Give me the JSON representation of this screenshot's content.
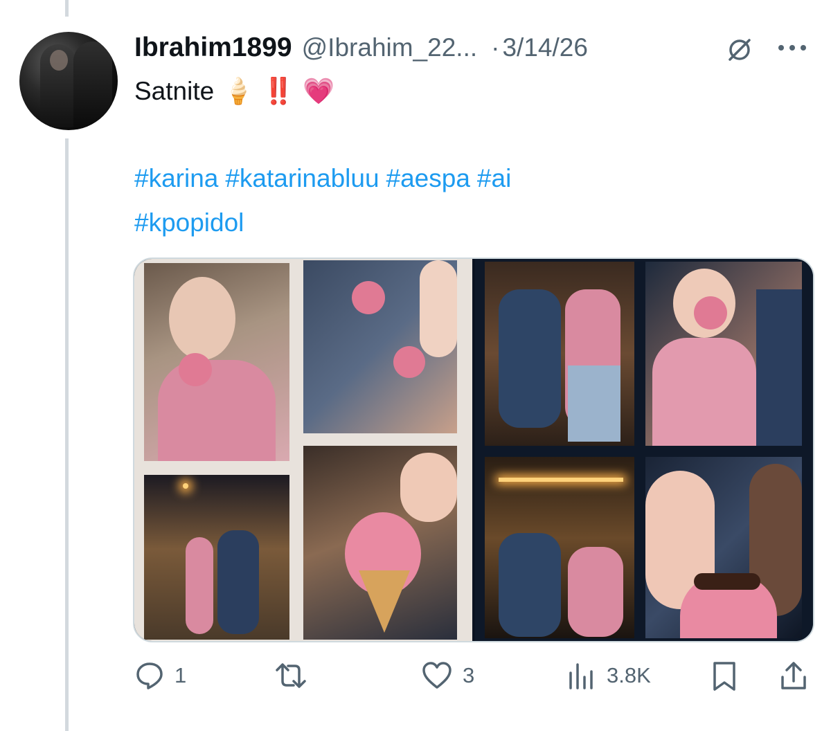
{
  "tweet": {
    "display_name": "Ibrahim1899",
    "handle": "@Ibrahim_22...",
    "separator": "·",
    "date": "3/14/26",
    "text": "Satnite",
    "emojis": [
      "🍦",
      "‼️",
      "💗"
    ],
    "hashtags_line1": [
      "#karina",
      "#katarinabluu",
      "#aespa",
      "#ai"
    ],
    "hashtags_line2": [
      "#kpopidol"
    ]
  },
  "icons": {
    "avatar": "profile-avatar",
    "grok": "grok-icon",
    "more": "more-options-icon"
  },
  "actions": {
    "reply_count": "1",
    "repost_count": "",
    "like_count": "3",
    "views_count": "3.8K"
  },
  "colors": {
    "link": "#1d9bf0",
    "secondary_text": "#536471",
    "thread_line": "#d3d9de"
  }
}
